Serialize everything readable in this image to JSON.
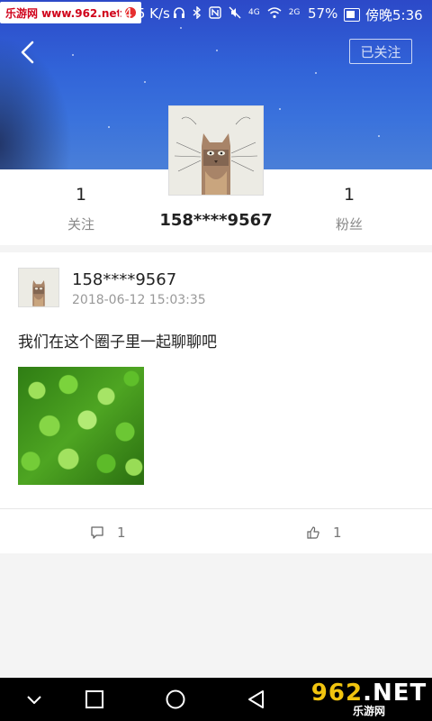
{
  "status_bar": {
    "watermark": "乐游网 www.962.net",
    "speed": "14.5 K/s",
    "icons": [
      "headset-icon",
      "bluetooth-icon",
      "nfc-icon",
      "mute-icon",
      "signal-4g-icon",
      "wifi-icon",
      "signal-2g-icon"
    ],
    "network_labels": {
      "g4": "4G",
      "g2": "2G"
    },
    "battery": "57%",
    "time": "傍晚5:36"
  },
  "header": {
    "follow_label": "已关注"
  },
  "profile": {
    "following_count": "1",
    "following_label": "关注",
    "name": "158****9567",
    "followers_count": "1",
    "followers_label": "粉丝"
  },
  "post": {
    "author": "158****9567",
    "timestamp": "2018-06-12 15:03:35",
    "text": "我们在这个圈子里一起聊聊吧",
    "comment_count": "1",
    "like_count": "1"
  },
  "nav_bar": {
    "buttons": [
      "back-triangle",
      "home-circle",
      "recents-square",
      "notifications-chevron"
    ]
  },
  "watermark_bottom": {
    "brand_prefix": "9",
    "brand_middle": "62",
    "brand_suffix": ".NET",
    "subtitle": "乐游网"
  }
}
